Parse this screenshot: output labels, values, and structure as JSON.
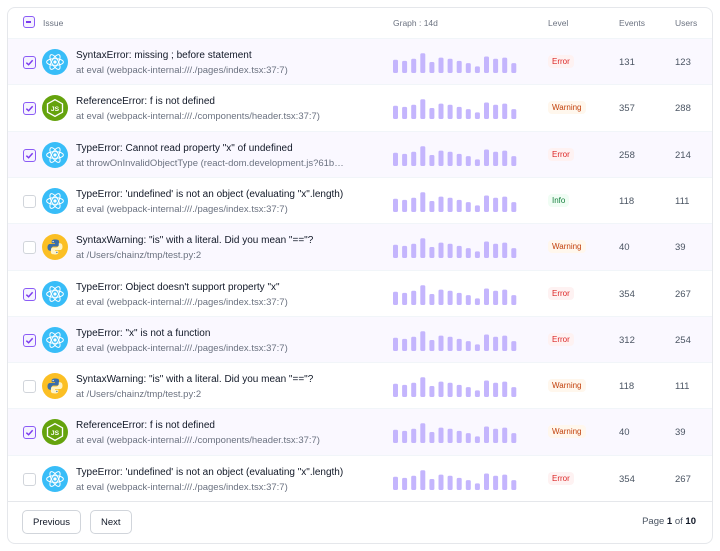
{
  "header": {
    "issue": "Issue",
    "graph": "Graph : 14d",
    "level": "Level",
    "events": "Events",
    "users": "Users"
  },
  "colors": {
    "accent": "#8b5cf6",
    "bar": "#c4b5fd",
    "error": "#dc2626",
    "warning": "#c2410c",
    "info": "#15803d"
  },
  "graph_values": [
    0.6,
    0.55,
    0.65,
    0.9,
    0.5,
    0.7,
    0.65,
    0.55,
    0.45,
    0.3,
    0.75,
    0.65,
    0.7,
    0.45
  ],
  "rows": [
    {
      "checked": true,
      "icon": "react-icon",
      "type": "SyntaxError",
      "message": "missing ; before statement",
      "location": "at eval (webpack-internal:///./pages/index.tsx:37:7)",
      "level": "Error",
      "events": "131",
      "users": "123"
    },
    {
      "checked": true,
      "icon": "nodejs-icon",
      "type": "ReferenceError",
      "message": "f is not defined",
      "location": "at eval (webpack-internal:///./components/header.tsx:37:7)",
      "level": "Warning",
      "events": "357",
      "users": "288"
    },
    {
      "checked": true,
      "icon": "react-icon",
      "type": "TypeError",
      "message": "Cannot read property \"x\" of undefined",
      "location": "at throwOnInvalidObjectType (react-dom.development.js?61b…",
      "level": "Error",
      "events": "258",
      "users": "214"
    },
    {
      "checked": false,
      "icon": "react-icon",
      "type": "TypeError",
      "message": "'undefined' is not an object (evaluating \"x\".length)",
      "location": "at eval (webpack-internal:///./pages/index.tsx:37:7)",
      "level": "Info",
      "events": "118",
      "users": "111"
    },
    {
      "checked": false,
      "icon": "python-icon",
      "type": "SyntaxWarning",
      "message": "\"is\" with a literal. Did you mean \"==\"?",
      "location": "at /Users/chainz/tmp/test.py:2",
      "level": "Warning",
      "events": "40",
      "users": "39"
    },
    {
      "checked": true,
      "icon": "react-icon",
      "type": "TypeError",
      "message": "Object doesn't support property \"x\"",
      "location": "at eval (webpack-internal:///./pages/index.tsx:37:7)",
      "level": "Error",
      "events": "354",
      "users": "267"
    },
    {
      "checked": true,
      "icon": "react-icon",
      "type": "TypeError",
      "message": "\"x\" is not a function",
      "location": "at eval (webpack-internal:///./pages/index.tsx:37:7)",
      "level": "Error",
      "events": "312",
      "users": "254"
    },
    {
      "checked": false,
      "icon": "python-icon",
      "type": "SyntaxWarning",
      "message": "\"is\" with a literal. Did you mean \"==\"?",
      "location": "at /Users/chainz/tmp/test.py:2",
      "level": "Warning",
      "events": "118",
      "users": "111"
    },
    {
      "checked": true,
      "icon": "nodejs-icon",
      "type": "ReferenceError",
      "message": "f is not defined",
      "location": "at eval (webpack-internal:///./components/header.tsx:37:7)",
      "level": "Warning",
      "events": "40",
      "users": "39"
    },
    {
      "checked": false,
      "icon": "react-icon",
      "type": "TypeError",
      "message": "'undefined' is not an object (evaluating \"x\".length)",
      "location": "at eval (webpack-internal:///./pages/index.tsx:37:7)",
      "level": "Error",
      "events": "354",
      "users": "267"
    }
  ],
  "footer": {
    "previous_label": "Previous",
    "next_label": "Next",
    "page_prefix": "Page",
    "current_page": "1",
    "page_of": "of",
    "total_pages": "10"
  }
}
